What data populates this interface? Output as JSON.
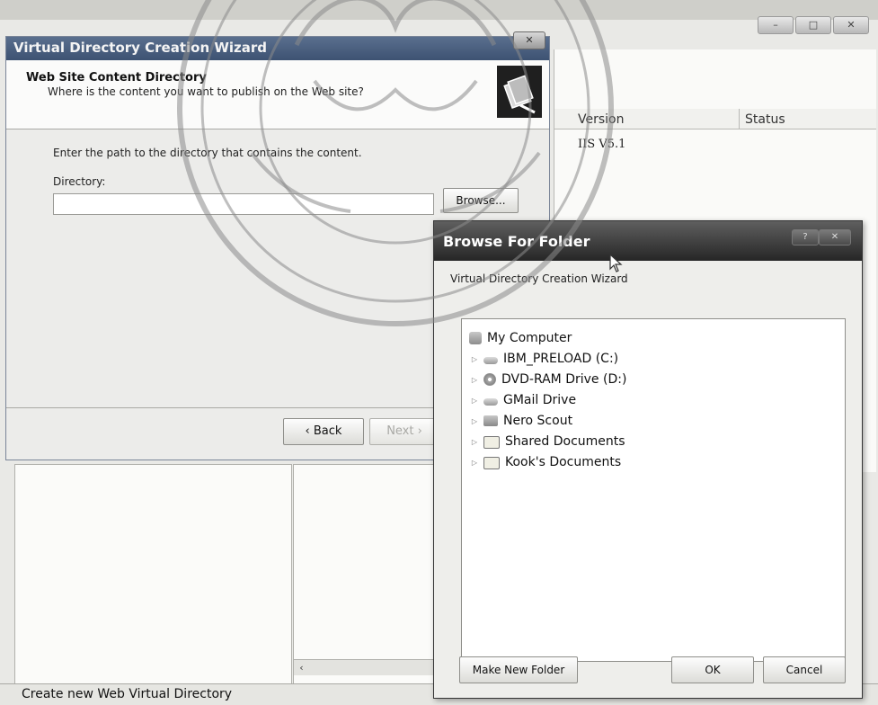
{
  "background_window": {
    "list_columns": [
      "Version",
      "Status"
    ],
    "list_rows": [
      {
        "version": "IIS V5.1",
        "status": ""
      }
    ],
    "status_text": "Create new Web Virtual Directory",
    "scroll_left_glyph": "‹"
  },
  "wizard": {
    "title": "Virtual Directory Creation Wizard",
    "close_glyph": "✕",
    "header_title": "Web Site Content Directory",
    "header_subtitle": "Where is the content you want to publish on the Web site?",
    "instruction": "Enter the path to the directory that contains the content.",
    "directory_label": "Directory:",
    "directory_value": "",
    "browse_label": "Browse...",
    "back_label": "‹ Back",
    "next_label": "Next ›"
  },
  "browse_dialog": {
    "title": "Browse For Folder",
    "help_glyph": "?",
    "close_glyph": "✕",
    "description": "Virtual Directory Creation Wizard",
    "tree": [
      {
        "label": "My Computer",
        "icon": "computer-icon",
        "expandable": false
      },
      {
        "label": "IBM_PRELOAD (C:)",
        "icon": "hard-drive-icon",
        "expandable": true
      },
      {
        "label": "DVD-RAM Drive (D:)",
        "icon": "dvd-drive-icon",
        "expandable": true
      },
      {
        "label": "GMail Drive",
        "icon": "hard-drive-icon",
        "expandable": true
      },
      {
        "label": "Nero Scout",
        "icon": "nero-scout-icon",
        "expandable": true
      },
      {
        "label": "Shared Documents",
        "icon": "folder-icon",
        "expandable": true
      },
      {
        "label": "Kook's Documents",
        "icon": "folder-icon",
        "expandable": true
      }
    ],
    "new_folder_label": "Make New Folder",
    "ok_label": "OK",
    "cancel_label": "Cancel"
  },
  "colors": {
    "wizard_title_bar": "#4a5f80",
    "dialog_title_bar": "#3a3a3a",
    "watermark": "#8a8a8a"
  }
}
